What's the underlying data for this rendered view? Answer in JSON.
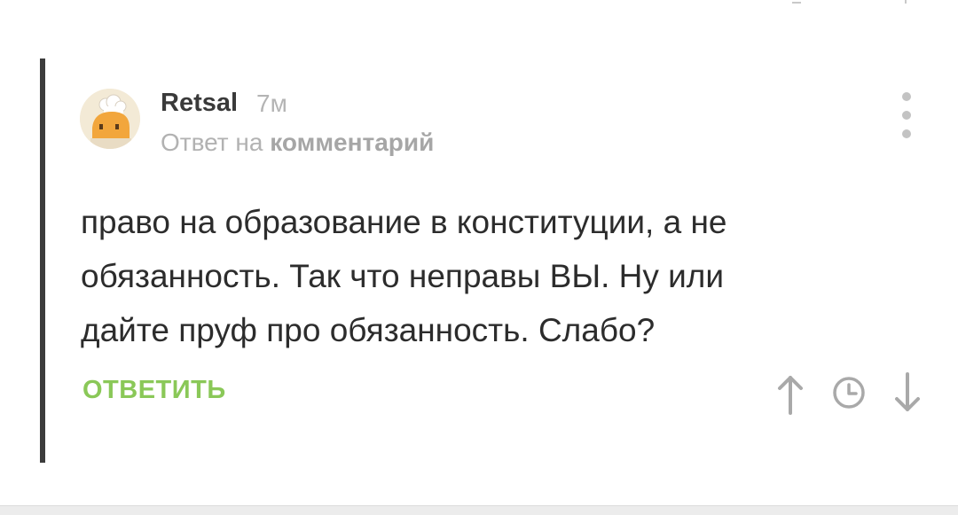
{
  "comment": {
    "author": "Retsal",
    "time": "7м",
    "reply_prefix": "Ответ на",
    "reply_link": "комментарий",
    "body_lines": [
      "право на образование в конституции, а не",
      "обязанность. Так что неправы ВЫ. Ну или",
      "дайте пруф про обязанность. Слабо?"
    ],
    "reply_label": "ОТВЕТИТЬ"
  },
  "icons": {
    "avatar": "chef-hat-avatar-icon",
    "menu": "more-vertical-icon",
    "up": "arrow-up-icon",
    "history": "clock-icon",
    "down": "arrow-down-icon"
  },
  "colors": {
    "accent_green": "#8ac858",
    "text_dark": "#2c2c2c",
    "muted": "#b2b2b2",
    "thread_line": "#3c3c3c"
  }
}
